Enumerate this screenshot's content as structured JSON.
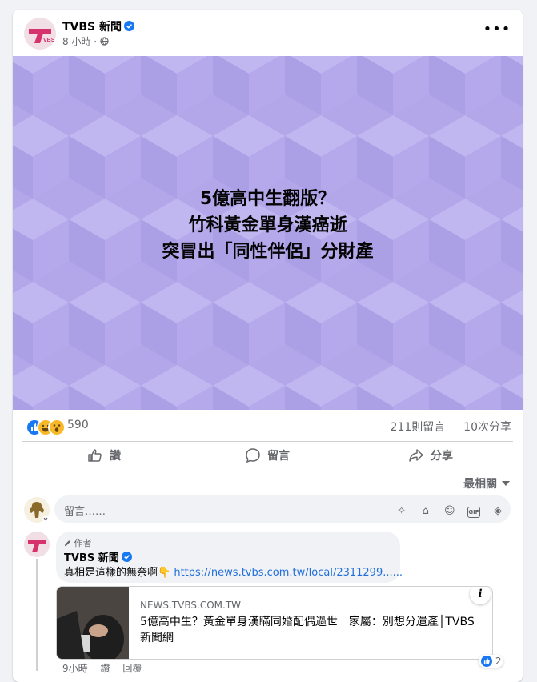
{
  "post": {
    "page_name": "TVBS 新聞",
    "time": "8 小時",
    "more_label": "•••",
    "headline": [
      "5億高中生翻版？",
      "竹科黃金單身漢癌逝",
      "突冒出「同性伴侶」分財產"
    ],
    "reaction_count": "590",
    "comments_count": "211則留言",
    "shares_count": "10次分享",
    "reactions": [
      "like",
      "haha",
      "wow"
    ]
  },
  "actions": {
    "like": "讚",
    "comment": "留言",
    "share": "分享"
  },
  "sort": {
    "label": "最相關"
  },
  "composer": {
    "placeholder": "留言……"
  },
  "comment": {
    "author_badge": "作者",
    "name": "TVBS 新聞",
    "text": "真相是這樣的無奈啊👇",
    "link": "https://news.tvbs.com.tw/local/2311299......",
    "preview": {
      "domain": "NEWS.TVBS.COM.TW",
      "title": "5億高中生？黃金單身漢瞞同婚配偶過世　家屬：別想分遺產│TVBS新聞網"
    },
    "footer": {
      "time": "9小時",
      "like": "讚",
      "reply": "回覆"
    },
    "like_count": "2"
  },
  "colors": {
    "accent": "#1877f2",
    "banner": "#b3a7ea",
    "link": "#216fdb"
  }
}
